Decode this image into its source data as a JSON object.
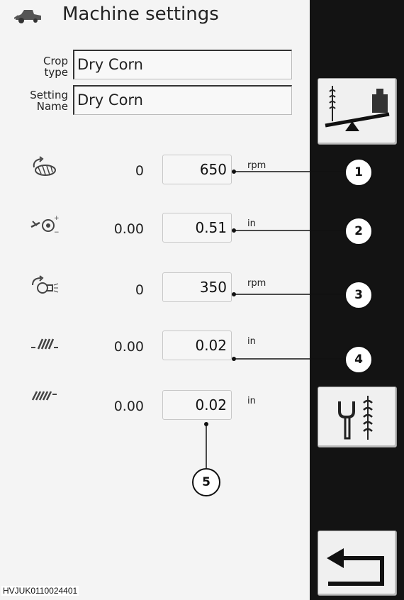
{
  "header": {
    "title": "Machine settings",
    "icon": "combine-harvester-icon"
  },
  "fields": {
    "crop_type": {
      "label_line1": "Crop",
      "label_line2": "type",
      "value": "Dry Corn"
    },
    "setting_name": {
      "label_line1": "Setting",
      "label_line2": "Name",
      "value": "Dry Corn"
    }
  },
  "settings": [
    {
      "icon": "rotor-speed-icon",
      "current": "0",
      "value": "650",
      "unit": "rpm",
      "callout": "1"
    },
    {
      "icon": "concave-clearance-icon",
      "current": "0.00",
      "value": "0.51",
      "unit": "in",
      "callout": "2"
    },
    {
      "icon": "fan-speed-icon",
      "current": "0",
      "value": "350",
      "unit": "rpm",
      "callout": "3"
    },
    {
      "icon": "upper-sieve-icon",
      "current": "0.00",
      "value": "0.02",
      "unit": "in",
      "callout": "4"
    },
    {
      "icon": "lower-sieve-icon",
      "current": "0.00",
      "value": "0.02",
      "unit": "in",
      "callout": "5"
    }
  ],
  "rail": {
    "buttons": [
      "crop-weight-balance-icon",
      "wrench-crop-settings-icon",
      "back-arrow-icon"
    ]
  },
  "figure_ref": "HVJUK0110024401",
  "colors": {
    "background": "#f4f4f4",
    "rail": "#131313"
  }
}
